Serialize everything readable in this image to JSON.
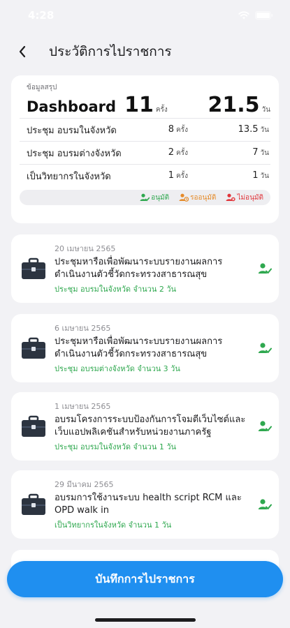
{
  "status_bar": {
    "time": "4:28"
  },
  "nav": {
    "title": "ประวัติการไปราชการ"
  },
  "summary": {
    "label": "ข้อมูลสรุป",
    "title": "Dashboard",
    "total_count": "11",
    "count_unit": "ครั้ง",
    "total_days": "21.5",
    "days_unit": "วัน",
    "rows": [
      {
        "label": "ประชุม อบรมในจังหวัด",
        "count": "8",
        "days": "13.5"
      },
      {
        "label": "ประชุม อบรมต่างจังหวัด",
        "count": "2",
        "days": "7"
      },
      {
        "label": "เป็นวิทยากรในจังหวัด",
        "count": "1",
        "days": "1"
      }
    ],
    "legend": {
      "approved": "อนุมัติ",
      "pending": "รออนุมัติ",
      "rejected": "ไม่อนุมัติ"
    }
  },
  "items": [
    {
      "date": "20 เมษายน 2565",
      "title": "ประชุมหารือเพื่อพัฒนาระบบรายงานผลการดำเนินงานตัวชี้วัดกระทรวงสาธารณสุข",
      "sub": "ประชุม อบรมในจังหวัด จำนวน 2 วัน"
    },
    {
      "date": "6 เมษายน 2565",
      "title": "ประชุมหารือเพื่อพัฒนาระบบรายงานผลการดำเนินงานตัวชี้วัดกระทรวงสาธารณสุข",
      "sub": "ประชุม อบรมต่างจังหวัด จำนวน 3 วัน"
    },
    {
      "date": "1 เมษายน 2565",
      "title": "อบรมโครงการระบบป้องกันการโจมตีเว็บไซต์และเว็บแอปพลิเคชันสำหรับหน่วยงานภาครัฐ",
      "sub": "ประชุม อบรมในจังหวัด จำนวน 1 วัน"
    },
    {
      "date": "29 มีนาคม 2565",
      "title": "อบรมการใช้งานระบบ health script RCM และ OPD walk in",
      "sub": "เป็นวิทยากรในจังหวัด จำนวน 1 วัน"
    }
  ],
  "cta": {
    "label": "บันทึกการไปราชการ"
  },
  "colors": {
    "accent": "#1f8ff0",
    "approved": "#2fa84f",
    "pending": "#e58b2a",
    "rejected": "#e0353b"
  },
  "icons": [
    "back-icon",
    "briefcase-icon",
    "approved-user-icon",
    "pending-user-icon",
    "rejected-user-icon",
    "wifi-icon",
    "battery-icon"
  ]
}
